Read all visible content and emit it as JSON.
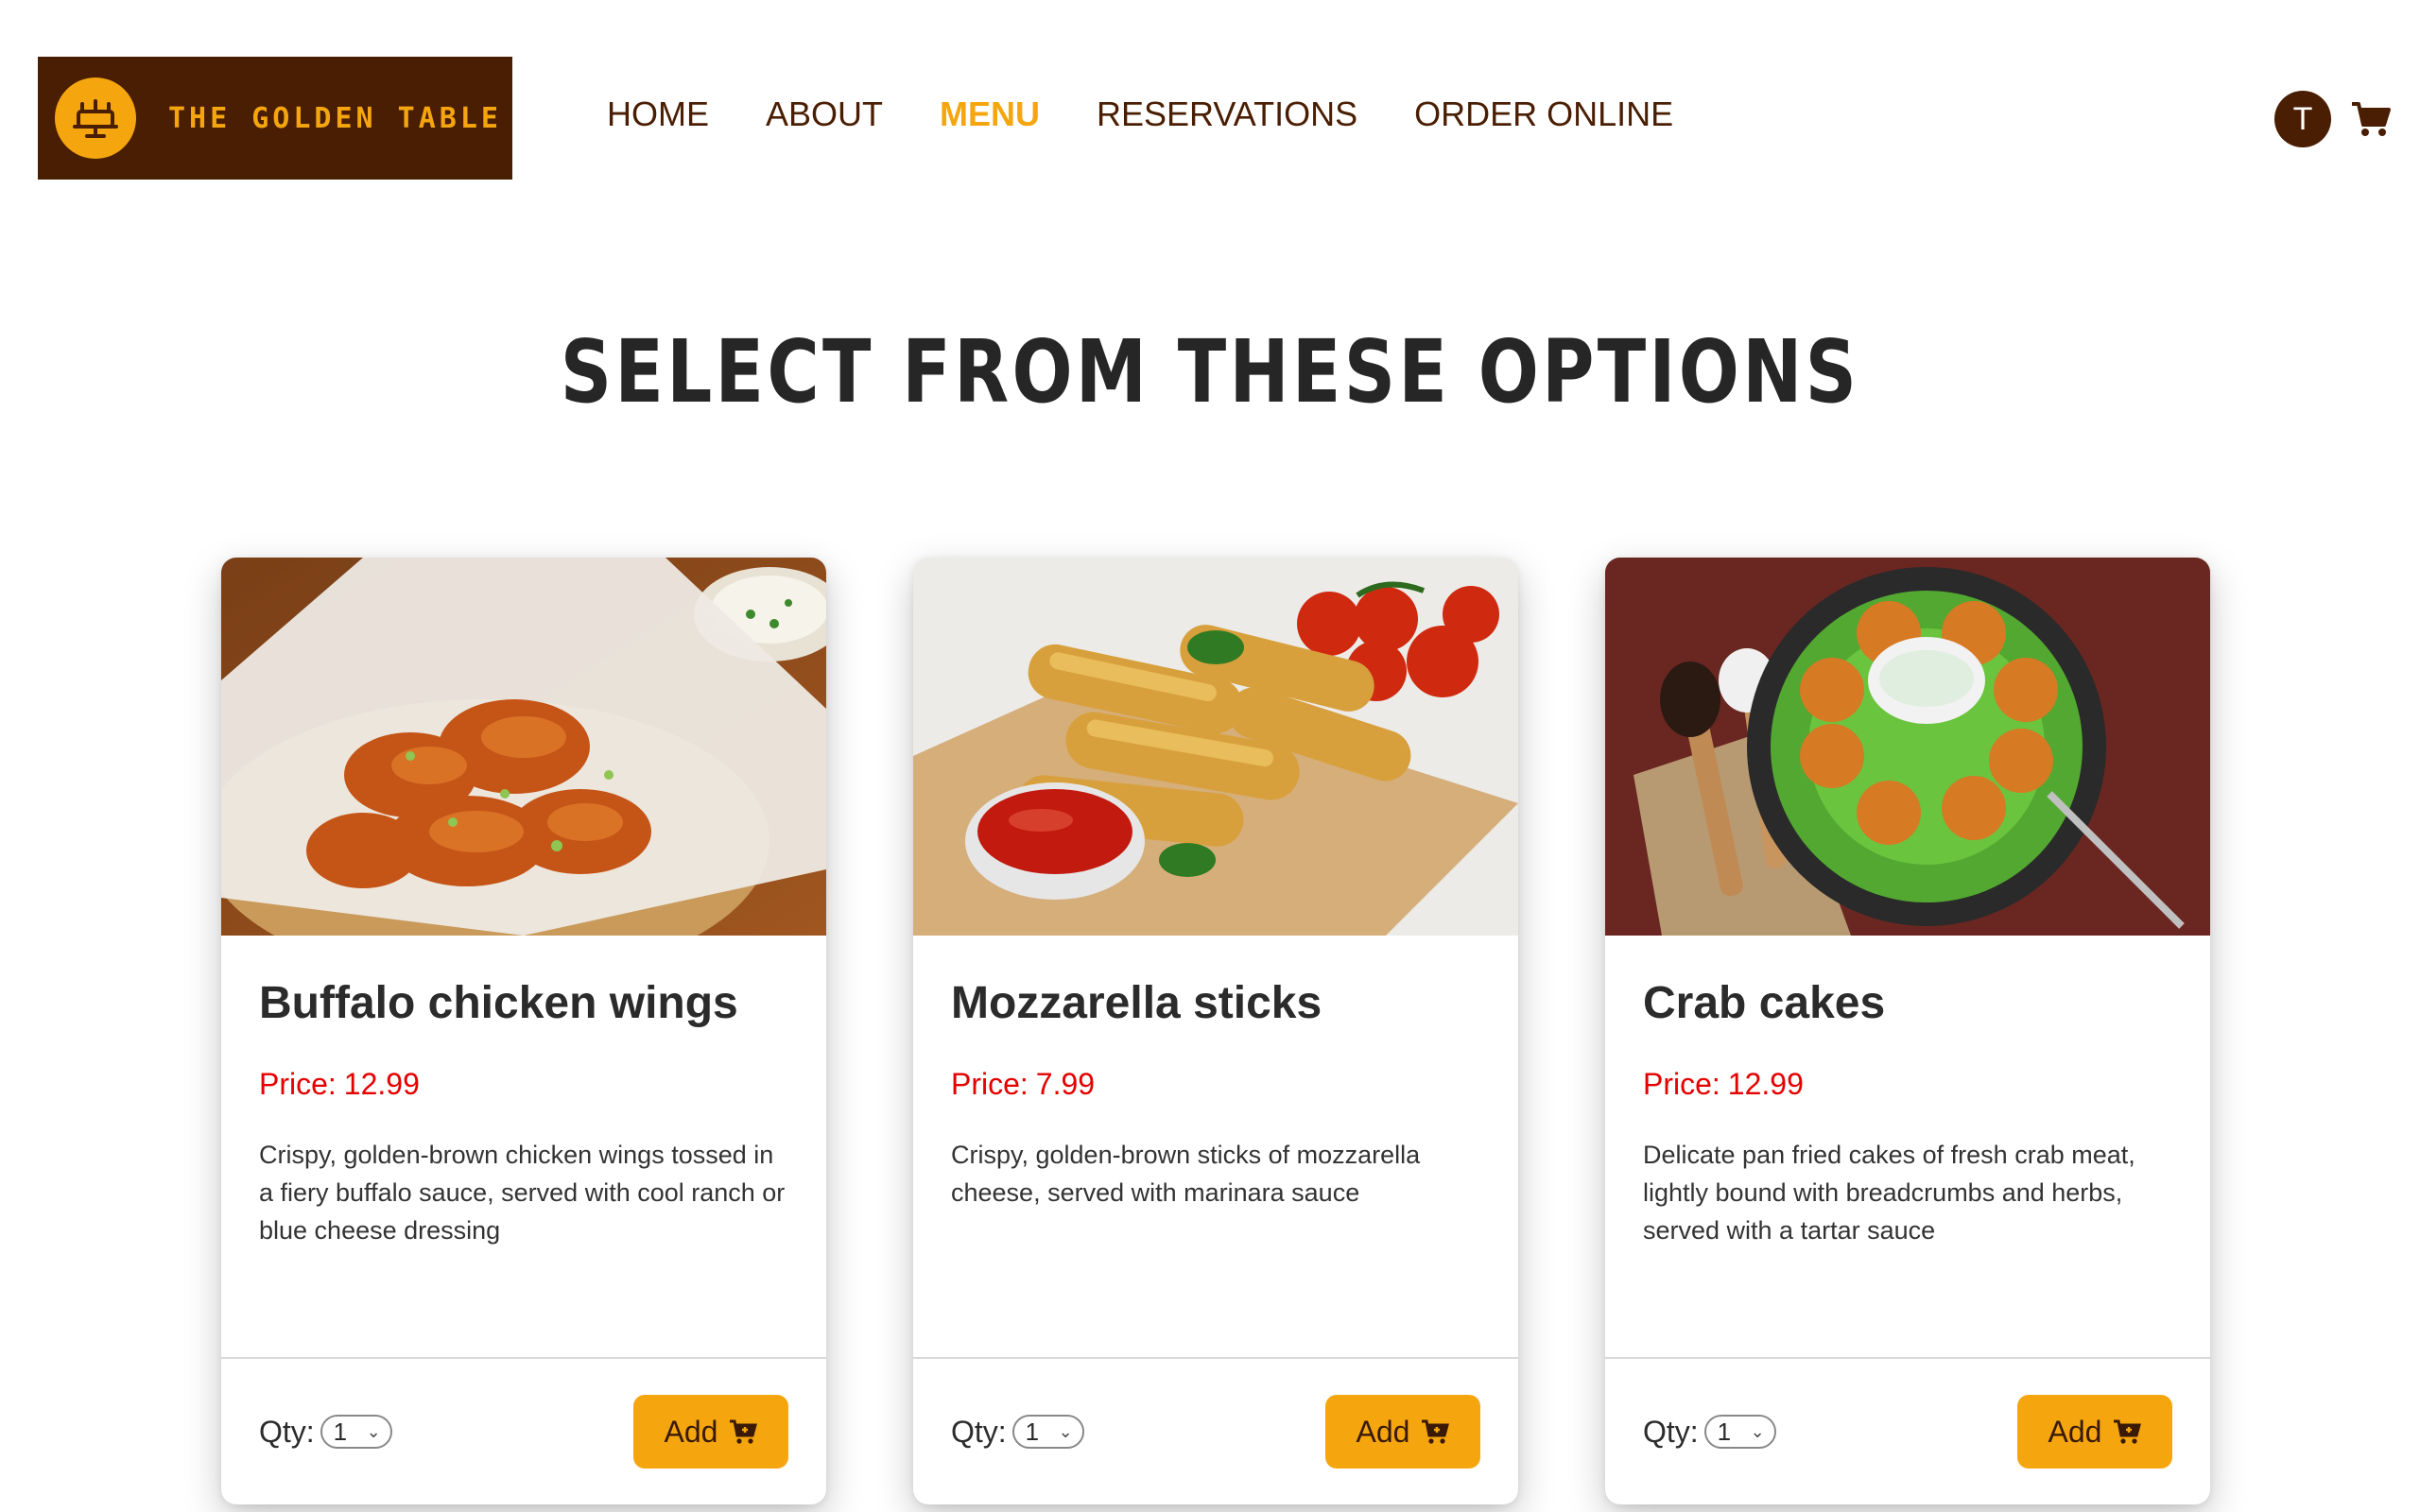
{
  "brand": {
    "name": "THE GOLDEN TABLE",
    "colors": {
      "primary": "#4a1e03",
      "accent": "#f5a60f",
      "price": "#e50000"
    }
  },
  "nav": {
    "items": [
      "HOME",
      "ABOUT",
      "MENU",
      "RESERVATIONS",
      "ORDER ONLINE"
    ],
    "active": "MENU"
  },
  "user": {
    "avatar_initial": "T"
  },
  "icons": {
    "logo": "serving-table-icon",
    "cart": "shopping-cart-icon",
    "add": "cart-add-icon"
  },
  "page": {
    "title": "SELECT FROM THESE OPTIONS"
  },
  "cards": [
    {
      "name": "Buffalo chicken wings",
      "price_label": "Price:",
      "price": "12.99",
      "description": "Crispy, golden-brown chicken wings tossed in a fiery buffalo sauce, served with cool ranch or blue cheese dressing",
      "qty_label": "Qty:",
      "qty": "1",
      "add_label": "Add"
    },
    {
      "name": "Mozzarella sticks",
      "price_label": "Price:",
      "price": "7.99",
      "description": "Crispy, golden-brown sticks of mozzarella cheese, served with marinara sauce",
      "qty_label": "Qty:",
      "qty": "1",
      "add_label": "Add"
    },
    {
      "name": "Crab cakes",
      "price_label": "Price:",
      "price": "12.99",
      "description": "Delicate pan fried cakes of fresh crab meat, lightly bound with breadcrumbs and herbs, served with a tartar sauce",
      "qty_label": "Qty:",
      "qty": "1",
      "add_label": "Add"
    }
  ]
}
